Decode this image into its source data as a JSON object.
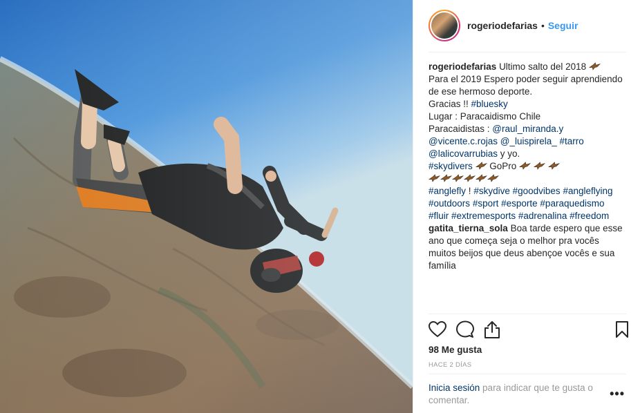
{
  "post": {
    "username": "rogeriodefarias",
    "separator": "•",
    "follow_label": "Seguir",
    "caption": {
      "line1": "Ultimo salto del 2018",
      "line2": "Para el 2019 Espero poder seguir aprendiendo",
      "line3": "de ese hermoso deporte.",
      "line4_text": "Gracias !! ",
      "line4_tag": "#bluesky",
      "line5": "Lugar : Paracaidismo Chile",
      "line6_text": "Paracaidistas : ",
      "line6_tag": "@raul_miranda.y",
      "line7_tag1": "@vicente.c.rojas",
      "line7_tag2": "@_luispirela_",
      "line7_tag3": "#tarro",
      "line8_tag": "@lalicovarrubias",
      "line8_text": " y yo.",
      "line9_tag": "#skydivers",
      "line9_text": " GoPro",
      "line11_tag1": "#anglefly",
      "line11_text": " ! ",
      "line11_tag2": "#skydive",
      "line11_tag3": "#goodvibes",
      "line11_tag4": "#angleflying",
      "line12_tag1": "#outdoors",
      "line12_tag2": "#sport",
      "line12_tag3": "#esporte",
      "line12_tag4": "#paraquedismo",
      "line13_tag1": "#fluir",
      "line13_tag2": "#extremesports",
      "line13_tag3": "#adrenalina",
      "line13_tag4": "#freedom"
    },
    "comment": {
      "username": "gatita_tierna_sola",
      "text": "Boa tarde espero que esse ano que começa seja o melhor pra vocês muitos beijos que deus abençoe vocês e sua família"
    },
    "likes": "98 Me gusta",
    "timestamp": "HACE 2 DÍAS",
    "login": {
      "link": "Inicia sesión",
      "text": " para indicar que te gusta o comentar."
    },
    "more_label": "•••"
  },
  "icons": [
    "heart-icon",
    "comment-icon",
    "share-icon",
    "bookmark-icon",
    "eagle-emoji-icon"
  ],
  "colors": {
    "link": "#003569",
    "follow": "#3897f0",
    "muted": "#999999",
    "text": "#262626"
  }
}
